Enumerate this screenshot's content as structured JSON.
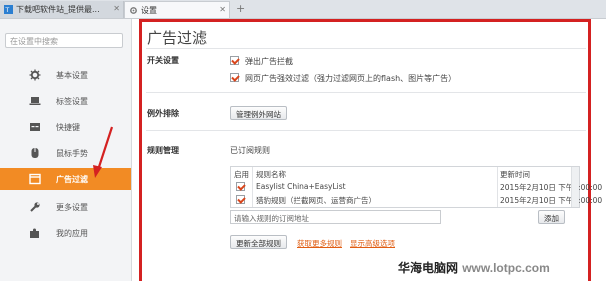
{
  "tabs": [
    {
      "title": "下载吧软件站_提供最..."
    },
    {
      "title": "设置"
    }
  ],
  "sidebar": {
    "search_placeholder": "在设置中搜索",
    "items": [
      {
        "label": "基本设置",
        "icon": "gear-icon"
      },
      {
        "label": "标签设置",
        "icon": "laptop-icon"
      },
      {
        "label": "快捷键",
        "icon": "keyboard-icon"
      },
      {
        "label": "鼠标手势",
        "icon": "mouse-icon"
      },
      {
        "label": "广告过滤",
        "icon": "window-icon",
        "active": true
      },
      {
        "label": "更多设置",
        "icon": "wrench-icon"
      },
      {
        "label": "我的应用",
        "icon": "puzzle-icon"
      }
    ]
  },
  "main": {
    "title": "广告过滤",
    "switch_section": {
      "label": "开关设置",
      "options": [
        {
          "text": "弹出广告拦截",
          "checked": true
        },
        {
          "text": "网页广告强效过滤（强力过滤网页上的flash、图片等广告）",
          "checked": true
        }
      ]
    },
    "exclusion_section": {
      "label": "例外排除",
      "button": "管理例外网站"
    },
    "rules_section": {
      "label": "规则管理",
      "subscribed_label": "已订阅规则",
      "columns": [
        "启用",
        "规则名称",
        "更新时间"
      ],
      "rows": [
        {
          "enabled": true,
          "name": "Easylist China+EasyList",
          "time": "2015年2月10日 下午6:00:00"
        },
        {
          "enabled": true,
          "name": "猎豹规则（拦截网页、运营商广告）",
          "time": "2015年2月10日 下午6:00:00"
        }
      ],
      "input_placeholder": "请输入规则的订阅地址",
      "add_button": "添加",
      "update_button": "更新全部规则",
      "more_rules_link": "获取更多规则",
      "advanced_link": "显示高级选项"
    }
  },
  "watermark": {
    "text1": "华海电脑网",
    "text2": "www.lotpc.com"
  },
  "colors": {
    "active": "#f28b24",
    "highlight_border": "#d42121",
    "link": "#e05d12"
  }
}
